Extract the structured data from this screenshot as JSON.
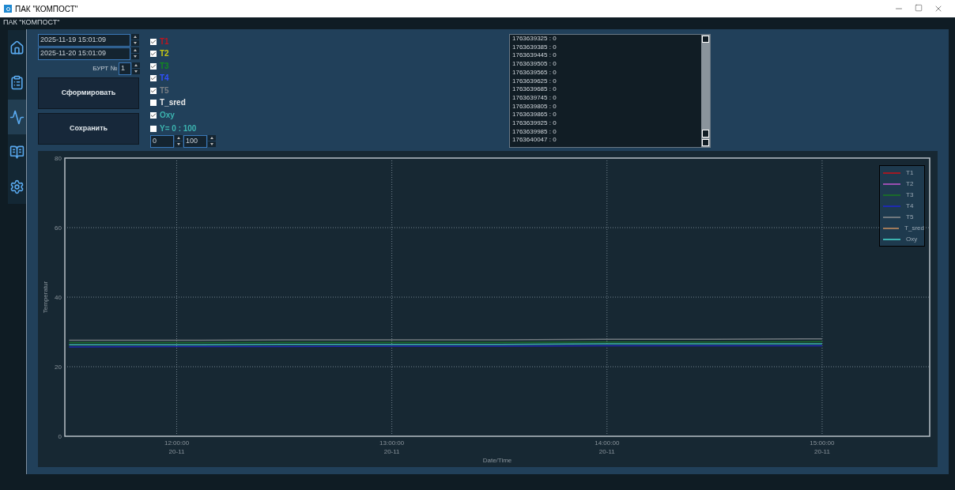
{
  "window": {
    "title": "ПАК \"КОМПОСТ\""
  },
  "app_header": "ПАК \"КОМПОСТ\"",
  "sidebar": {
    "items": [
      {
        "kind": "home",
        "selected": false
      },
      {
        "kind": "report",
        "selected": false
      },
      {
        "kind": "chart",
        "selected": true
      },
      {
        "kind": "map",
        "selected": false
      },
      {
        "kind": "settings",
        "selected": false
      }
    ]
  },
  "controls": {
    "date_from": "2025-11-19 15:01:09",
    "date_to": "2025-11-20 15:01:09",
    "burt_label": "БУРТ №",
    "burt_value": "1",
    "buttons": [
      "Сформировать",
      "Сохранить"
    ]
  },
  "series_toggles": [
    {
      "label": "T1",
      "checked": true,
      "color": "#c0141e"
    },
    {
      "label": "T2",
      "checked": true,
      "color": "#c8c814"
    },
    {
      "label": "T3",
      "checked": true,
      "color": "#128a1e"
    },
    {
      "label": "T4",
      "checked": true,
      "color": "#3050ff"
    },
    {
      "label": "T5",
      "checked": true,
      "color": "#7a7f85"
    },
    {
      "label": "T_sred",
      "checked": false,
      "color": "#e8e8e8"
    },
    {
      "label": "Oxy",
      "checked": true,
      "color": "#3cb4b0"
    },
    {
      "label": "Y= 0 : 100",
      "checked": false,
      "color": "#3cb4b0"
    }
  ],
  "y_range": {
    "min": "0",
    "max": "100"
  },
  "log": [
    "1763639325 : 0",
    "1763639385 : 0",
    "1763639445 : 0",
    "1763639505 : 0",
    "1763639565 : 0",
    "1763639625 : 0",
    "1763639685 : 0",
    "1763639745 : 0",
    "1763639805 : 0",
    "1763639865 : 0",
    "1763639925 : 0",
    "1763639985 : 0",
    "1763640047 : 0"
  ],
  "chart": {
    "chart_data": {
      "type": "line",
      "xlabel": "Date/Time",
      "ylabel": "Temperatur",
      "categories": [
        null,
        "12:00:00 20-11",
        null,
        "13:00:00 20-11",
        null,
        "14:00:00 20-11",
        null,
        "15:00:00 20-11",
        null
      ],
      "ylim": [
        0,
        80
      ],
      "grid": true,
      "yticks": [
        0,
        20,
        40,
        60,
        80
      ],
      "series": [
        {
          "name": "T1",
          "color": "#a01a24",
          "values": [
            null,
            null,
            null,
            null,
            null,
            null,
            null,
            null,
            null
          ]
        },
        {
          "name": "T2",
          "color": "#9a4fb0",
          "values": [
            null,
            null,
            null,
            null,
            null,
            null,
            null,
            null,
            null
          ]
        },
        {
          "name": "T3",
          "color": "#1a6a2a",
          "values": [
            26.9,
            26.9,
            27,
            27,
            27,
            27.1,
            27.1,
            27.2,
            null
          ]
        },
        {
          "name": "T4",
          "color": "#1e2ab0",
          "values": [
            25.7,
            25.8,
            25.8,
            25.9,
            25.9,
            26,
            26,
            26,
            null
          ]
        },
        {
          "name": "T5",
          "color": "#70787e",
          "values": [
            27.6,
            27.6,
            27.7,
            27.7,
            27.7,
            27.9,
            27.9,
            28,
            null
          ]
        },
        {
          "name": "T_sred",
          "color": "#a07a5a",
          "values": [
            null,
            null,
            null,
            null,
            null,
            null,
            null,
            null,
            null
          ]
        },
        {
          "name": "Oxy",
          "color": "#3cb4b0",
          "values": [
            26.3,
            26.3,
            26.4,
            26.4,
            26.4,
            26.6,
            26.6,
            26.6,
            null
          ]
        }
      ]
    }
  }
}
